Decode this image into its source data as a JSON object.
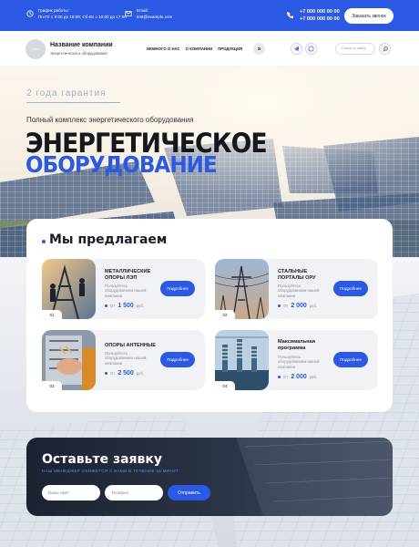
{
  "topbar": {
    "hours_title": "График работы:",
    "hours_value": "Пн-Пт с 9:00 до 18:00; Сб-Вс с 10:00 до 17:00",
    "email_title": "Email:",
    "email_value": "test@example.com",
    "phone1": "+7 000 000 00 00",
    "phone2": "+7 000 000 00 00",
    "call_label": "Заказать звонок",
    "accent": "#2b59e3"
  },
  "header": {
    "logo_text": "Лого",
    "company_name": "Название компании",
    "company_sub": "Энергетического оборудования",
    "nav": [
      "НЕМНОГО О НАС",
      "О КОМПАНИИ",
      "ПРОДУКЦИЯ"
    ],
    "search_placeholder": "Поиск по сайту"
  },
  "hero": {
    "guarantee": "2 года гарантия",
    "subtitle": "Полный комплекс энергетического оборудования",
    "title_line1": "ЭНЕРГЕТИЧЕСКОЕ",
    "title_line2": "ОБОРУДОВАНИЕ"
  },
  "offers": {
    "title": "Мы предлагаем",
    "products": [
      {
        "num": "01",
        "name": "МЕТАЛЛИЧЕСКИЕ ОПОРЫ ЛЭП",
        "desc": "Пользуйтесь оборудованием нашей компании",
        "from": "От",
        "price": "1 500",
        "currency": "руб.",
        "button": "Подробнее"
      },
      {
        "num": "02",
        "name": "СТАЛЬНЫЕ ПОРТАЛЫ ОРУ",
        "desc": "Пользуйтесь оборудованием нашей компании",
        "from": "От",
        "price": "2 000",
        "currency": "руб.",
        "button": "Подробнее"
      },
      {
        "num": "03",
        "name": "ОПОРЫ АНТЕННЫЕ",
        "desc": "Пользуйтесь оборудованием нашей компании",
        "from": "От",
        "price": "2 500",
        "currency": "руб.",
        "button": "Подробнее"
      },
      {
        "num": "04",
        "name": "Максимальная программа",
        "desc": "Пользуйтесь оборудованием нашей компании",
        "from": "От",
        "price": "2 000",
        "currency": "руб.",
        "button": "Подробнее"
      }
    ]
  },
  "request": {
    "title": "Оставьте заявку",
    "subtitle": "НАШ МЕНЕДЖЕР СВЯЖЕТСЯ С ВАМИ В ТЕЧЕНИЕ 15 МИНУТ",
    "name_placeholder": "Ваше имя*",
    "phone_placeholder": "Телефон",
    "send_label": "Отправить"
  }
}
